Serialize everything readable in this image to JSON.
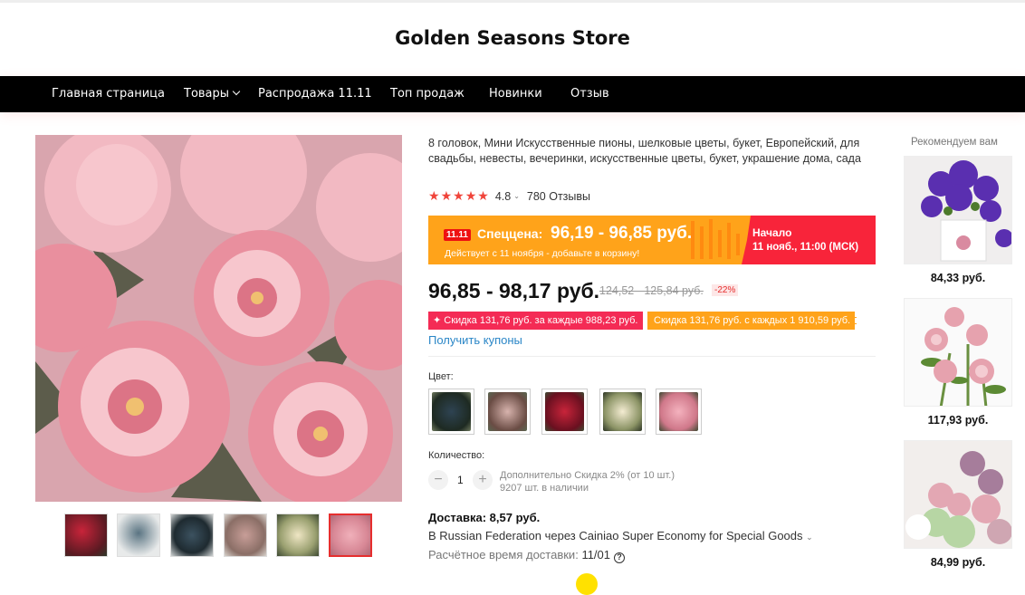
{
  "store": {
    "name": "Golden Seasons Store"
  },
  "nav": {
    "items": [
      "Главная страница",
      "Товары",
      "Распродажа 11.11",
      "Топ продаж",
      "Новинки",
      "Отзыв"
    ]
  },
  "product": {
    "title": "8 головок, Мини Искусственные пионы, шелковые цветы, букет, Европейский, для свадьбы, невесты, вечеринки, искусственные цветы, букет, украшение дома, сада",
    "rating": "4.8",
    "reviews": "780 Отзывы",
    "promo": {
      "badge": "11.11",
      "label": "Спеццена:",
      "price": "96,19 - 96,85 руб.",
      "note": "Действует с 11 ноября - добавьте в корзину!",
      "start_label": "Начало",
      "start_time": "11 нояб., 11:00 (МСК)"
    },
    "price": "96,85 - 98,17 руб.",
    "old_price": "124,52 - 125,84 руб.",
    "discount": "-22%",
    "coupons": [
      "✦ Скидка 131,76 руб. за каждые 988,23 руб.",
      "Скидка 131,76 руб. с каждых 1 910,59 руб."
    ],
    "get_coupons": "Получить купоны",
    "color_label": "Цвет:",
    "quantity_label": "Количество:",
    "quantity": "1",
    "qty_note1": "Дополнительно Скидка 2% (от 10 шт.)",
    "qty_note2": "9207 шт. в наличии",
    "shipping": {
      "cost": "Доставка: 8,57 руб.",
      "method": "В Russian Federation через Cainiao Super Economy for Special Goods",
      "eta_label": "Расчётное время доставки:",
      "eta": "11/01"
    }
  },
  "recommend": {
    "title": "Рекомендуем вам",
    "prices": [
      "84,33 руб.",
      "117,93 руб.",
      "84,99 руб."
    ]
  },
  "colors": {
    "accent": "#e62e2e",
    "orange": "#ffa31a",
    "pink": "#f42b55",
    "link": "#2a86c7"
  }
}
